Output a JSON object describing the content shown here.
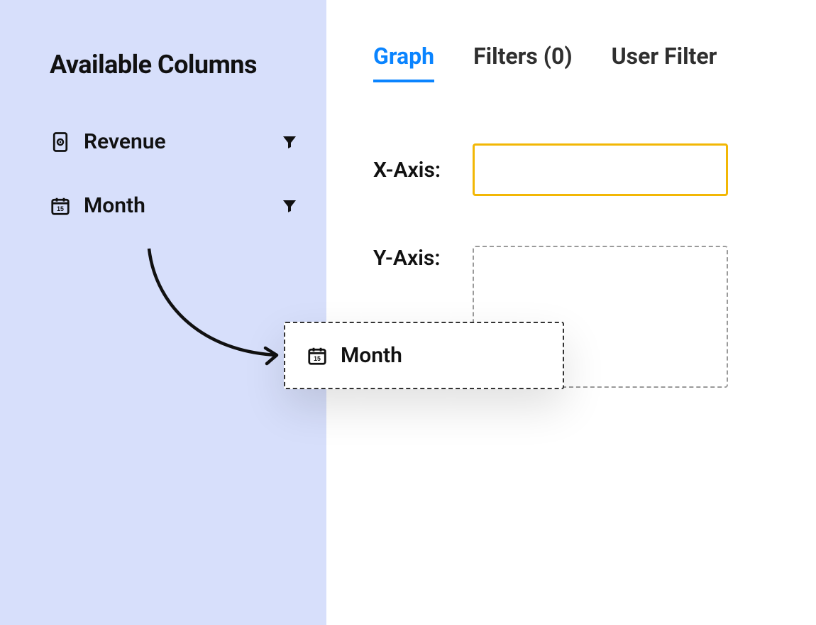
{
  "sidebar": {
    "title": "Available Columns",
    "items": [
      {
        "label": "Revenue",
        "icon": "money-icon"
      },
      {
        "label": "Month",
        "icon": "calendar-icon"
      }
    ]
  },
  "tabs": {
    "items": [
      {
        "label": "Graph",
        "active": true
      },
      {
        "label": "Filters (0)",
        "active": false
      },
      {
        "label": "User Filter",
        "active": false
      }
    ]
  },
  "axes": {
    "x_label": "X-Axis:",
    "y_label": "Y-Axis:"
  },
  "drag_ghost": {
    "label": "Month",
    "icon": "calendar-icon"
  },
  "colors": {
    "sidebar_bg": "#d7dffb",
    "tab_active": "#0a84ff",
    "x_dropzone_border": "#f2b705",
    "y_dropzone_border": "#9a9a9a"
  }
}
